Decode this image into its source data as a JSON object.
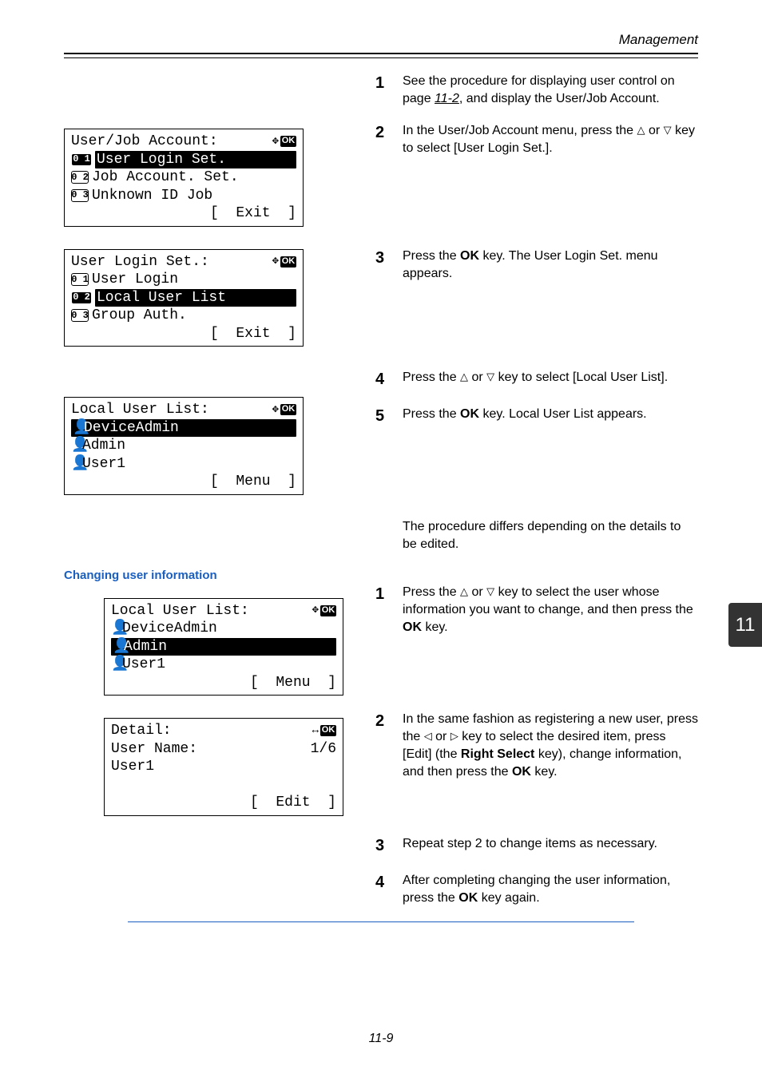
{
  "running_head": "Management",
  "side_tab": "11",
  "page_number": "11-9",
  "subheading": "Changing user information",
  "sym": {
    "ok": "OK"
  },
  "lcd1": {
    "title": "User/Job Account:",
    "r1_num": "0 1",
    "r1": "User Login Set.",
    "r2_num": "0 2",
    "r2": "Job Account. Set.",
    "r3_num": "0 3",
    "r3": "Unknown ID Job",
    "soft": "[  Exit  ]"
  },
  "lcd2": {
    "title": "User Login Set.:",
    "r1_num": "0 1",
    "r1": "User Login",
    "r2_num": "0 2",
    "r2": "Local User List",
    "r3_num": "0 3",
    "r3": "Group Auth.",
    "soft": "[  Exit  ]"
  },
  "lcd3": {
    "title": "Local User List:",
    "r1": "DeviceAdmin",
    "r2": "Admin",
    "r3": "User1",
    "soft": "[  Menu  ]"
  },
  "lcd4": {
    "title": "Local User List:",
    "r1": "DeviceAdmin",
    "r2": "Admin",
    "r3": "User1",
    "soft": "[  Menu  ]"
  },
  "lcd5": {
    "title": "Detail:",
    "r1a": "User Name:",
    "r1b": "1/6",
    "r2": "User1",
    "soft": "[  Edit  ]"
  },
  "steps": {
    "s1": {
      "n": "1",
      "pre": "See the procedure for displaying user control on page ",
      "link": "11-2",
      "post": ", and display the User/Job Account."
    },
    "s2": {
      "n": "2",
      "pre": "In the User/Job Account menu, press the ",
      "mid": " or ",
      "post": " key to select [User Login Set.]."
    },
    "s3": {
      "n": "3",
      "pre": "Press the ",
      "key": "OK",
      "post": " key. The User Login Set. menu appears."
    },
    "s4": {
      "n": "4",
      "pre": "Press the ",
      "mid": " or ",
      "post": " key to select [Local User List]."
    },
    "s5": {
      "n": "5",
      "pre": "Press the ",
      "key": "OK",
      "post": " key. Local User List appears."
    },
    "note": "The procedure differs depending on the details to be edited.",
    "c1": {
      "n": "1",
      "pre": "Press the ",
      "mid": " or ",
      "post1": " key to select the user whose information you want to change, and then press the ",
      "key": "OK",
      "post2": " key."
    },
    "c2": {
      "n": "2",
      "pre": "In the same fashion as registering a new user, press the ",
      "mid": " or ",
      "post1": " key to select the desired item, press [Edit] (the ",
      "key1": "Right Select",
      "post2": " key), change information, and then press the ",
      "key2": "OK",
      "post3": " key."
    },
    "c3": {
      "n": "3",
      "t": "Repeat step 2 to change items as necessary."
    },
    "c4": {
      "n": "4",
      "pre": "After completing changing the user information, press the ",
      "key": "OK",
      "post": " key again."
    }
  }
}
